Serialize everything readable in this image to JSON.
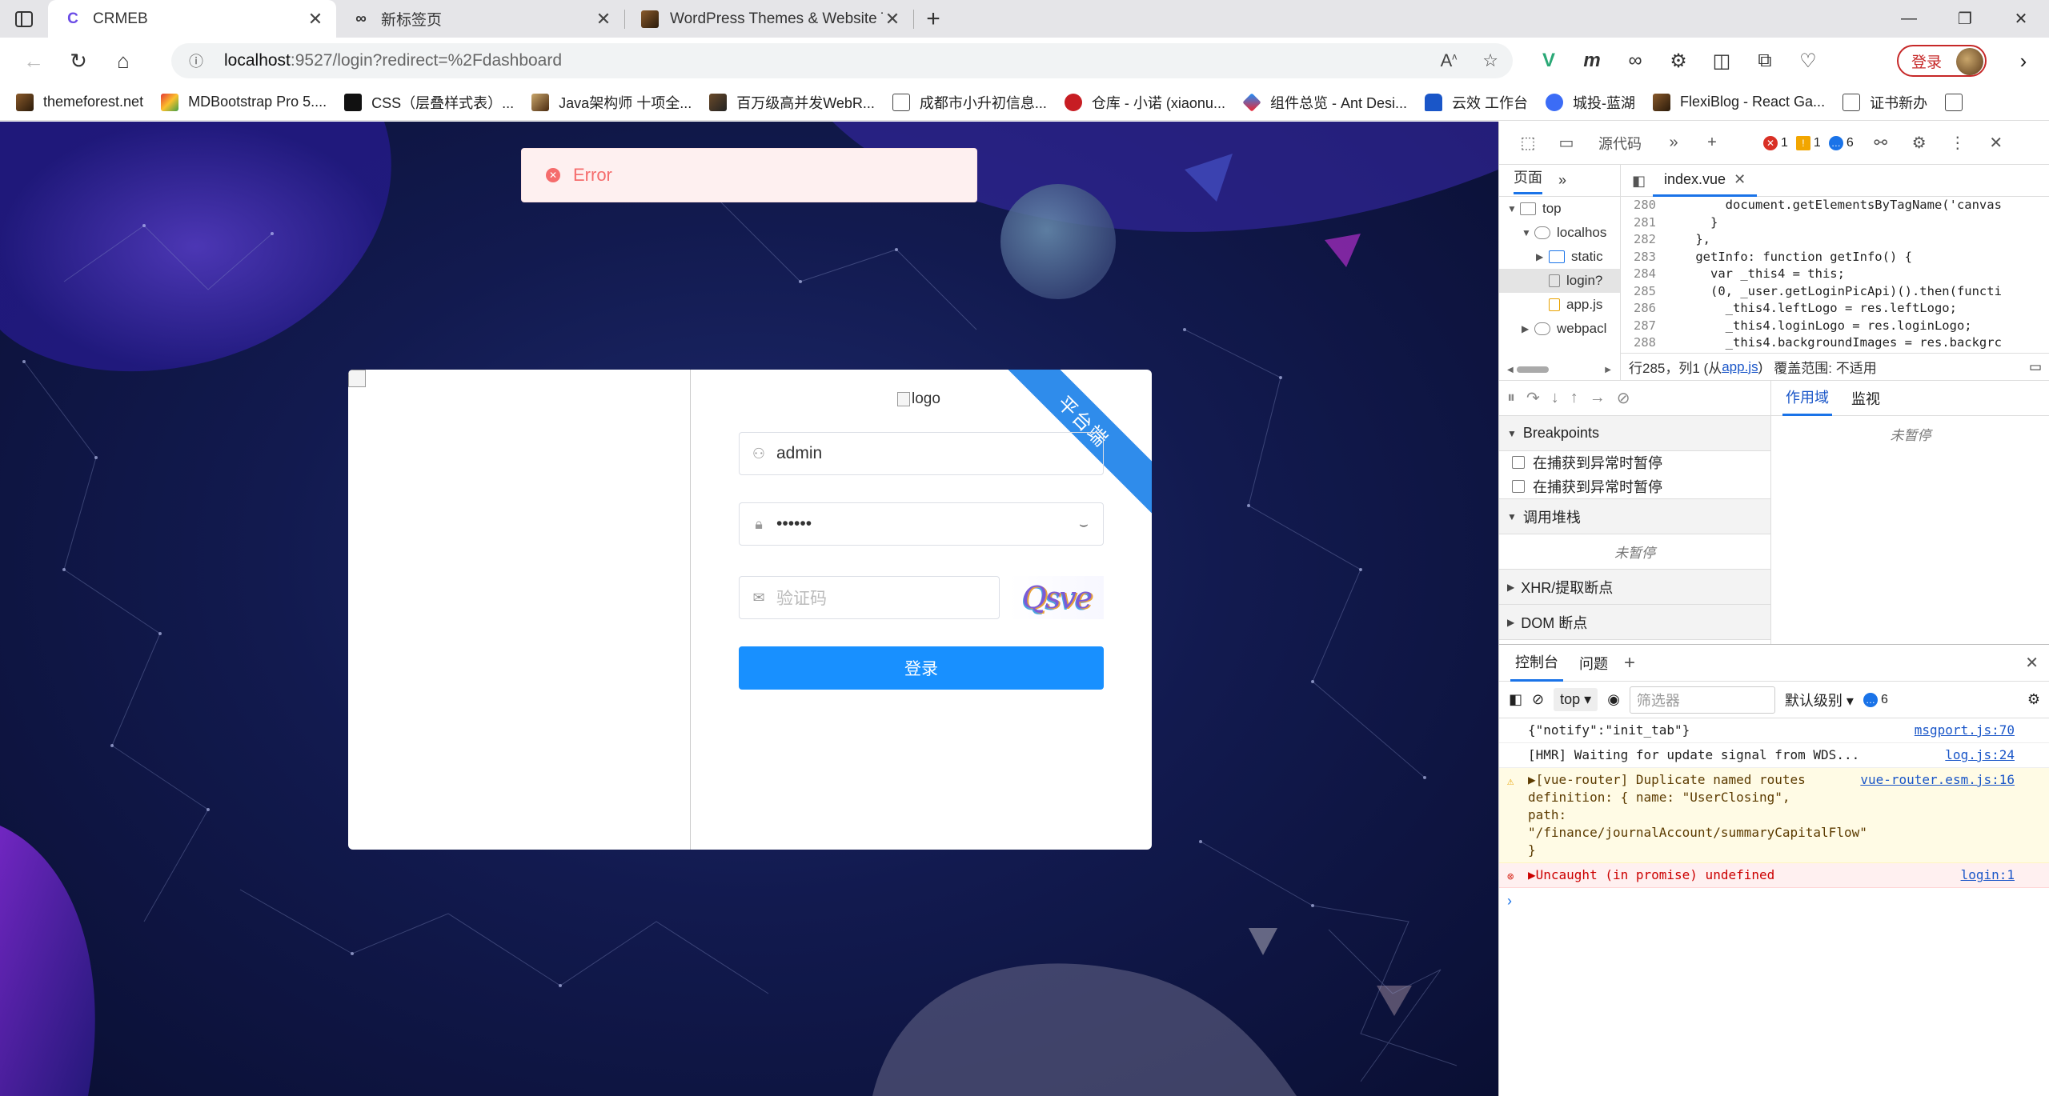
{
  "browser": {
    "tabs": [
      {
        "title": "CRMEB",
        "favicon": "C"
      },
      {
        "title": "新标签页",
        "favicon": "∞"
      },
      {
        "title": "WordPress Themes & Website Te",
        "favicon": ""
      }
    ],
    "url": {
      "host": "localhost",
      "path": ":9527/login?redirect=%2Fdashboard"
    },
    "profile_button": "登录",
    "bookmarks": [
      "themeforest.net",
      "MDBootstrap Pro 5....",
      "CSS（层叠样式表）...",
      "Java架构师 十项全...",
      "百万级高并发WebR...",
      "成都市小升初信息...",
      "仓库 - 小诺 (xiaonu...",
      "组件总览 - Ant Desi...",
      "云效 工作台",
      "城投-蓝湖",
      "FlexiBlog - React Ga...",
      "证书新办"
    ]
  },
  "login": {
    "error_message": "Error",
    "ribbon": "平台端",
    "logo_alt": "logo",
    "username": "admin",
    "password": "••••••",
    "captcha_placeholder": "验证码",
    "captcha_text": "Qsve",
    "submit_label": "登录"
  },
  "devtools": {
    "toolbar": {
      "sources_label": "源代码",
      "errors": "1",
      "warnings": "1",
      "messages": "6"
    },
    "nav_tab": "页面",
    "tree": [
      "top",
      "localhos",
      "static",
      "login?",
      "app.js",
      "webpacl"
    ],
    "editor_tab": "index.vue",
    "code": [
      {
        "ln": "280",
        "text": "        document.getElementsByTagName('canvas"
      },
      {
        "ln": "281",
        "text": "      }"
      },
      {
        "ln": "282",
        "text": "    },"
      },
      {
        "ln": "283",
        "text": "    getInfo: function getInfo() {"
      },
      {
        "ln": "284",
        "text": "      var _this4 = this;"
      },
      {
        "ln": "285",
        "text": "      (0, _user.getLoginPicApi)().then(functi"
      },
      {
        "ln": "286",
        "text": "        _this4.leftLogo = res.leftLogo;"
      },
      {
        "ln": "287",
        "text": "        _this4.loginLogo = res.loginLogo;"
      },
      {
        "ln": "288",
        "text": "        _this4.backgroundImages = res.backgrc"
      }
    ],
    "status": {
      "position": "行285，列1 (从",
      "link": "app.js",
      "close": ")",
      "coverage": "覆盖范围: 不适用"
    },
    "scope_tab": "作用域",
    "watch_tab": "监视",
    "not_paused": "未暂停",
    "breakpoints": "Breakpoints",
    "pause_caught_1": "在捕获到异常时暂停",
    "pause_caught_2": "在捕获到异常时暂停",
    "call_stack": "调用堆栈",
    "xhr_breakpoints": "XHR/提取断点",
    "dom_breakpoints": "DOM 断点",
    "console_tab": "控制台",
    "issues_tab": "问题",
    "context": "top",
    "filter_placeholder": "筛选器",
    "level": "默认级别",
    "level_count": "6",
    "messages": [
      {
        "type": "log",
        "text": "{\"notify\":\"init_tab\"}",
        "source": "msgport.js:70"
      },
      {
        "type": "log",
        "text": "[HMR] Waiting for update signal from WDS...",
        "source": "log.js:24"
      },
      {
        "type": "warn",
        "text": "▶[vue-router] Duplicate named routes\ndefinition: { name: \"UserClosing\",\npath: \"/finance/journalAccount/summaryCapitalFlow\" }",
        "source": "vue-router.esm.js:16"
      },
      {
        "type": "err",
        "text": "▶Uncaught (in promise) undefined",
        "source": "login:1"
      }
    ]
  }
}
